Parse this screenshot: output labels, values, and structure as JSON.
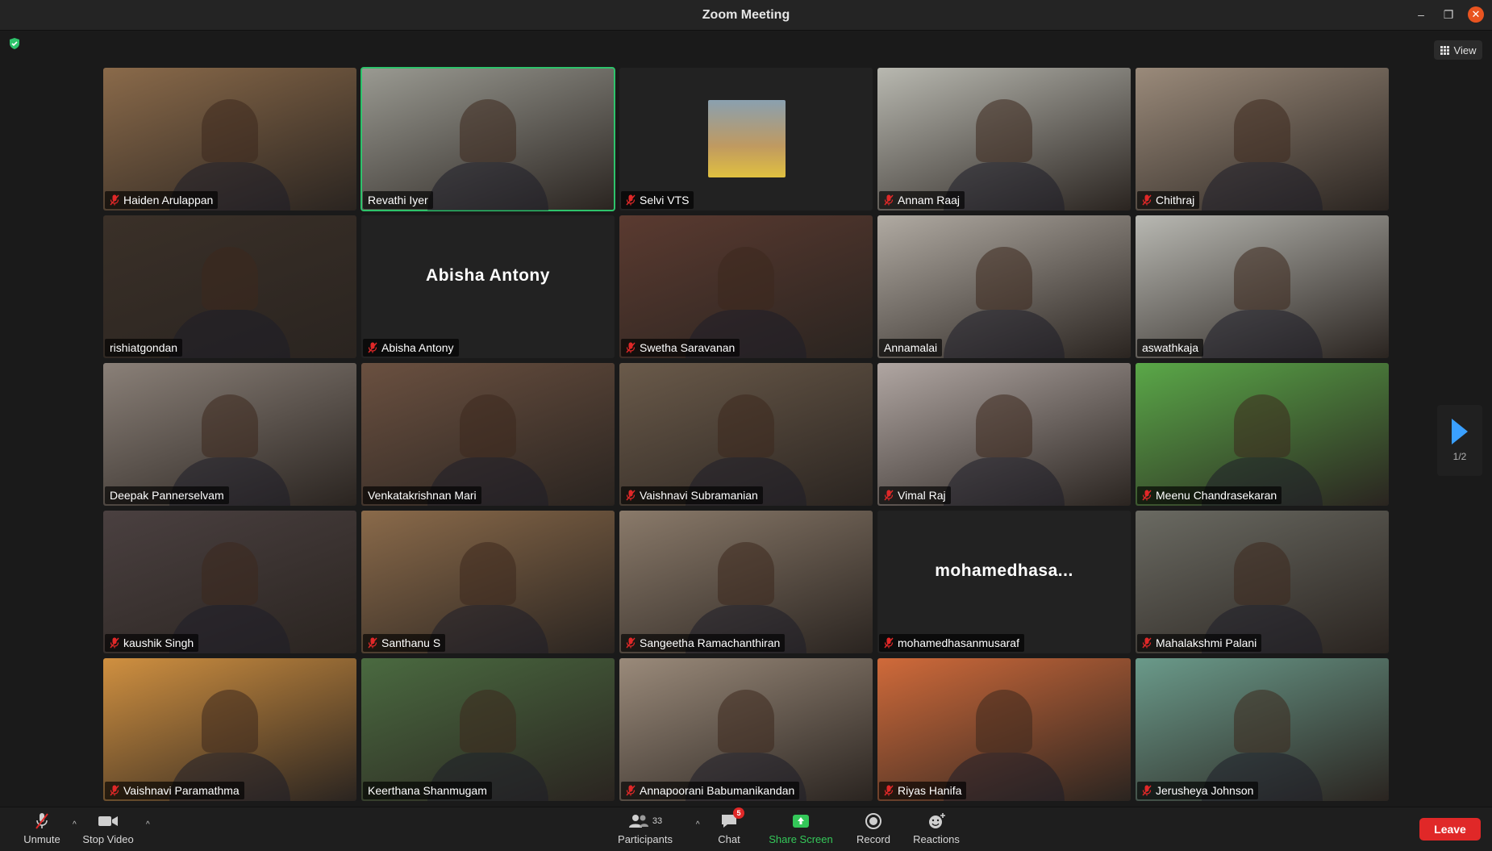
{
  "window": {
    "title": "Zoom Meeting"
  },
  "view_button": {
    "label": "View"
  },
  "participants_grid": [
    {
      "name": "Haiden Arulappan",
      "muted": true,
      "video": true,
      "bg": "#8a6a4a"
    },
    {
      "name": "Revathi Iyer",
      "muted": false,
      "video": true,
      "active": true,
      "bg": "#9a9a92"
    },
    {
      "name": "Selvi VTS",
      "muted": true,
      "video": false,
      "avatar": true,
      "bg": "#222222"
    },
    {
      "name": "Annam Raaj",
      "muted": true,
      "video": true,
      "bg": "#b8b8b0"
    },
    {
      "name": "Chithraj",
      "muted": true,
      "video": true,
      "bg": "#9a8a7a"
    },
    {
      "name": "rishiatgondan",
      "muted": false,
      "video": true,
      "bg": "#3a3028"
    },
    {
      "name": "Abisha Antony",
      "muted": true,
      "video": false,
      "center_name": "Abisha Antony",
      "bg": "#222222"
    },
    {
      "name": "Swetha Saravanan",
      "muted": true,
      "video": true,
      "bg": "#5a3a30"
    },
    {
      "name": "Annamalai",
      "muted": false,
      "video": true,
      "bg": "#b0aaa2"
    },
    {
      "name": "aswathkaja",
      "muted": false,
      "video": true,
      "bg": "#b8b8b2"
    },
    {
      "name": "Deepak Pannerselvam",
      "muted": false,
      "video": true,
      "bg": "#8a8078"
    },
    {
      "name": "Venkatakrishnan Mari",
      "muted": false,
      "video": true,
      "bg": "#6a5040"
    },
    {
      "name": "Vaishnavi Subramanian",
      "muted": true,
      "video": true,
      "bg": "#6a5a4a"
    },
    {
      "name": "Vimal Raj",
      "muted": true,
      "video": true,
      "bg": "#b0a6a2"
    },
    {
      "name": "Meenu Chandrasekaran",
      "muted": true,
      "video": true,
      "bg": "#5aa848"
    },
    {
      "name": "kaushik Singh",
      "muted": true,
      "video": true,
      "bg": "#4a4040"
    },
    {
      "name": "Santhanu S",
      "muted": true,
      "video": true,
      "bg": "#8a6a4a"
    },
    {
      "name": "Sangeetha Ramachanthiran",
      "muted": true,
      "video": true,
      "bg": "#8a7a6a"
    },
    {
      "name": "mohamedhasanmusaraf",
      "muted": true,
      "video": false,
      "center_name": "mohamedhasa...",
      "bg": "#222222"
    },
    {
      "name": "Mahalakshmi Palani",
      "muted": true,
      "video": true,
      "bg": "#6a6a62"
    },
    {
      "name": "Vaishnavi Paramathma",
      "muted": true,
      "video": true,
      "bg": "#d09040"
    },
    {
      "name": "Keerthana Shanmugam",
      "muted": false,
      "video": true,
      "bg": "#4a6a40"
    },
    {
      "name": "Annapoorani Babumanikandan",
      "muted": true,
      "video": true,
      "bg": "#9a8a7a"
    },
    {
      "name": "Riyas Hanifa",
      "muted": true,
      "video": true,
      "bg": "#d06a3a"
    },
    {
      "name": "Jerusheya Johnson",
      "muted": true,
      "video": true,
      "bg": "#6a9a8a"
    }
  ],
  "pagination": {
    "indicator": "1/2"
  },
  "toolbar": {
    "unmute": "Unmute",
    "stop_video": "Stop Video",
    "participants": "Participants",
    "participants_count": "33",
    "chat": "Chat",
    "chat_badge": "5",
    "share_screen": "Share Screen",
    "record": "Record",
    "reactions": "Reactions",
    "leave": "Leave"
  },
  "colors": {
    "active_speaker": "#2ec36b",
    "share_green": "#34c759",
    "leave_red": "#e02828",
    "next_arrow": "#3aa0ff"
  }
}
